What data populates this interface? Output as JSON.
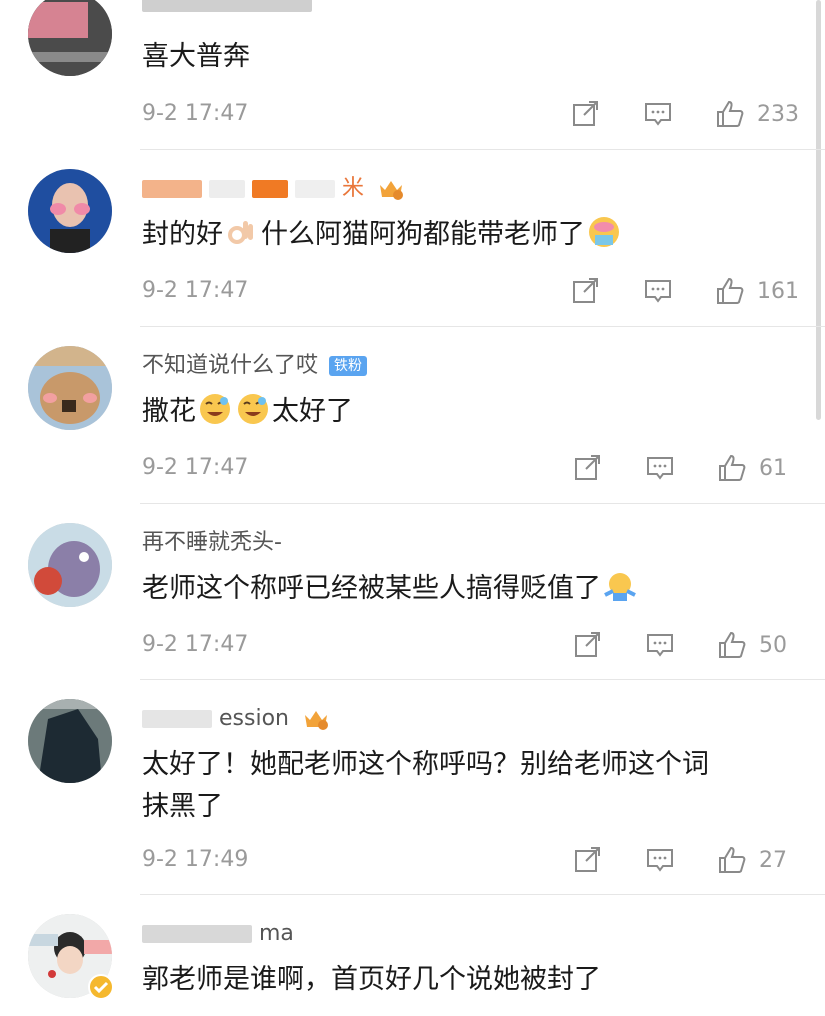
{
  "comments": [
    {
      "username": "",
      "text": "喜大普奔",
      "time": "9-2 17:47",
      "likes": "233",
      "badge": ""
    },
    {
      "username": "米",
      "text_parts": [
        "封的好",
        "什么阿猫阿狗都能带老师了"
      ],
      "time": "9-2 17:47",
      "likes": "161",
      "badge": "crown"
    },
    {
      "username": "不知道说什么了哎",
      "text_parts": [
        "撒花",
        "",
        "太好了"
      ],
      "time": "9-2 17:47",
      "likes": "61",
      "badge": "铁粉"
    },
    {
      "username": "再不睡就秃头-",
      "text": "老师这个称呼已经被某些人搞得贬值了",
      "time": "9-2 17:47",
      "likes": "50",
      "badge": ""
    },
    {
      "username": "ession",
      "text_line1": "太好了！她配老师这个称呼吗？别给老师这个词",
      "text_line2": "抹黑了",
      "time": "9-2 17:49",
      "likes": "27",
      "badge": "crown"
    },
    {
      "username": "ma",
      "text": "郭老师是谁啊，首页好几个说她被封了",
      "time": "",
      "likes": "",
      "badge": "verified"
    }
  ],
  "fan_badge_label": "铁粉",
  "colors": {
    "meta": "#9a9a9a",
    "divider": "#e6e6e6",
    "fan_badge": "#5aa4f0",
    "crown": "#f2a33a"
  },
  "icons": [
    "share-icon",
    "reply-icon",
    "like-icon",
    "crown-badge-icon",
    "verified-icon"
  ]
}
